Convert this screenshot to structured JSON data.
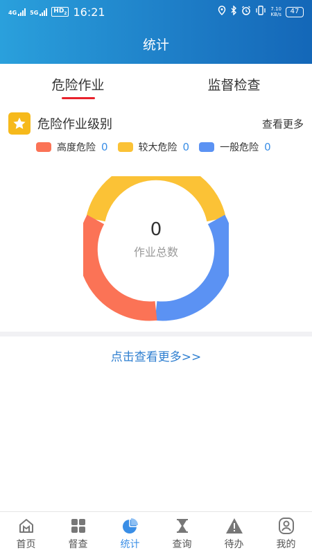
{
  "status_bar": {
    "network_1": "4G",
    "network_2": "5G",
    "hd": "HD",
    "hd_sub": "2",
    "time": "16:21",
    "speed_value": "7.10",
    "speed_unit": "KB/s",
    "battery": "47"
  },
  "header": {
    "title": "统计"
  },
  "tabs": [
    {
      "label": "危险作业",
      "active": true
    },
    {
      "label": "监督检查",
      "active": false
    }
  ],
  "section": {
    "title": "危险作业级别",
    "more_label": "查看更多"
  },
  "legend": [
    {
      "label": "高度危险",
      "count": "0",
      "color": "#fb7356"
    },
    {
      "label": "较大危险",
      "count": "0",
      "color": "#fbc236"
    },
    {
      "label": "一般危险",
      "count": "0",
      "color": "#5b92f3"
    }
  ],
  "donut": {
    "total": "0",
    "label": "作业总数"
  },
  "link": {
    "see_more": "点击查看更多>>"
  },
  "bottom_nav": [
    {
      "label": "首页",
      "icon": "home-icon",
      "active": false
    },
    {
      "label": "督查",
      "icon": "grid-icon",
      "active": false
    },
    {
      "label": "统计",
      "icon": "pie-chart-icon",
      "active": true
    },
    {
      "label": "查询",
      "icon": "hourglass-icon",
      "active": false
    },
    {
      "label": "待办",
      "icon": "warning-icon",
      "active": false
    },
    {
      "label": "我的",
      "icon": "user-icon",
      "active": false
    }
  ]
}
